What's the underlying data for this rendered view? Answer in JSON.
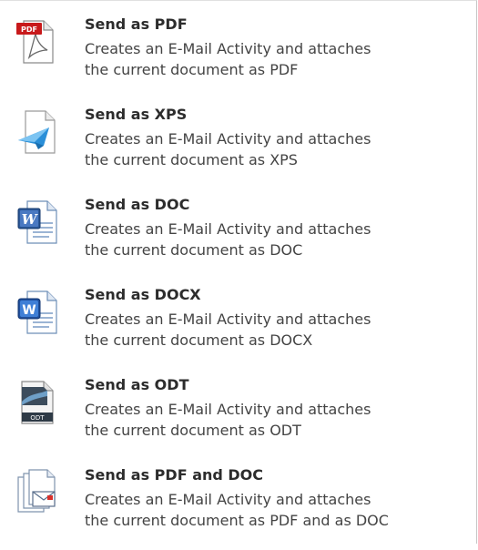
{
  "menu": {
    "items": [
      {
        "title": "Send as PDF",
        "desc_line1": "Creates an E-Mail Activity and attaches",
        "desc_line2": "the current document as PDF",
        "icon": "pdf-file-icon",
        "badge": "PDF"
      },
      {
        "title": "Send as XPS",
        "desc_line1": "Creates an E-Mail Activity and attaches",
        "desc_line2": "the current document as XPS",
        "icon": "xps-file-icon"
      },
      {
        "title": "Send as DOC",
        "desc_line1": "Creates an E-Mail Activity and attaches",
        "desc_line2": "the current document as DOC",
        "icon": "doc-file-icon",
        "badge": "W"
      },
      {
        "title": "Send as DOCX",
        "desc_line1": "Creates an E-Mail Activity and attaches",
        "desc_line2": "the current document as DOCX",
        "icon": "docx-file-icon",
        "badge": "W"
      },
      {
        "title": "Send as ODT",
        "desc_line1": "Creates an E-Mail Activity and attaches",
        "desc_line2": "the current document as ODT",
        "icon": "odt-file-icon",
        "badge": "ODT"
      },
      {
        "title": "Send as PDF and DOC",
        "desc_line1": "Creates an E-Mail Activity and attaches",
        "desc_line2": "the current document as PDF and as DOC",
        "icon": "multiple-documents-email-icon"
      }
    ]
  },
  "colors": {
    "title": "#2c2c2c",
    "description": "#444444",
    "hover": "#fcecc0",
    "pdf_red": "#c8191b",
    "word_blue": "#2b5797",
    "xps_blue": "#2a8fd8"
  }
}
